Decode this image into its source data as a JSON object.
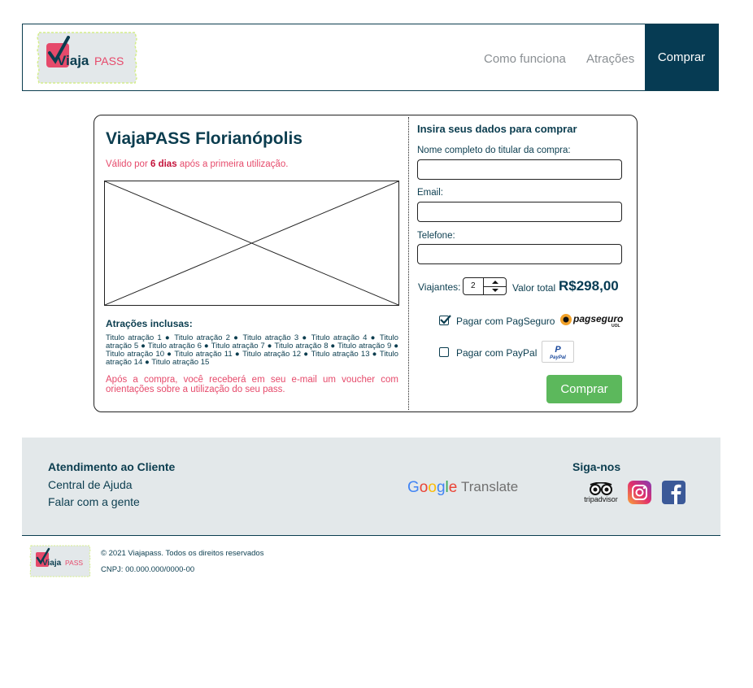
{
  "brand": {
    "logo_part1": "Viaja",
    "logo_part2": "PASS"
  },
  "nav": {
    "how_it_works": "Como funciona",
    "attractions": "Atrações",
    "buy": "Comprar"
  },
  "product": {
    "title": "ViajaPASS Florianópolis",
    "validity_prefix": "Válido por",
    "validity_days": "6 dias",
    "validity_suffix": "após a primeira utilização.",
    "attractions_title": "Atrações inclusas:",
    "attractions": [
      "Titulo atração 1",
      "Titulo atração 2",
      "Titulo atração 3",
      "Titulo atração 4",
      "Titulo atração 5",
      "Titulo atração 6",
      "Titulo atração 7",
      "Titulo atração 8",
      "Titulo atração 9",
      "Titulo atração 10",
      "Titulo atração 11",
      "Titulo atração 12",
      "Titulo atração 13",
      "Titulo atração 14",
      "Titulo atração 15"
    ],
    "attractions_text": "Titulo atração 1 ● Titulo atração 2 ● Titulo atração 3 ● Titulo atração 4 ● Titulo atração 5 ● Titulo atração 6 ● Titulo atração 7 ● Titulo atração 8 ● Titulo atração 9 ● Titulo atração 10 ● Titulo atração 11 ● Titulo atração 12 ● Titulo atração 13 ● Titulo atração 14 ● Titulo atração 15",
    "voucher_note": "Após a compra, você receberá em seu e-mail um voucher com orientações sobre a utilização do seu pass."
  },
  "form": {
    "title": "Insira seus dados para comprar",
    "name_label": "Nome completo do titular da compra:",
    "name_value": "",
    "email_label": "Email:",
    "email_value": "",
    "phone_label": "Telefone:",
    "phone_value": "",
    "travelers_label": "Viajantes:",
    "travelers_value": "2",
    "total_label": "Valor total",
    "total_value": "R$298,00",
    "pagseguro_label": "Pagar com PagSeguro",
    "pagseguro_checked": true,
    "pagseguro_logo_text": "pagseguro",
    "pagseguro_logo_sub": "UOL",
    "paypal_label": "Pagar com PayPal",
    "paypal_checked": false,
    "paypal_logo_text": "PayPal",
    "buy_label": "Comprar"
  },
  "footer": {
    "support_title": "Atendimento ao Cliente",
    "help_center": "Central de Ajuda",
    "contact": "Falar com a gente",
    "google": "Google",
    "translate": "Translate",
    "follow_title": "Siga-nos",
    "tripadvisor": "tripadvisor",
    "copyright": "© 2021 Viajapass. Todos os direitos reservados",
    "cnpj": "CNPJ: 00.000.000/0000-00"
  },
  "colors": {
    "primary": "#063b53",
    "accent": "#e64a6b",
    "buy_green": "#5cb85c",
    "footer_bg": "#e3e8ea"
  },
  "icons": {
    "ticket_logo": "ticket-logo-icon",
    "check": "check-icon",
    "instagram": "instagram-icon",
    "facebook": "facebook-icon",
    "tripadvisor": "tripadvisor-icon"
  }
}
